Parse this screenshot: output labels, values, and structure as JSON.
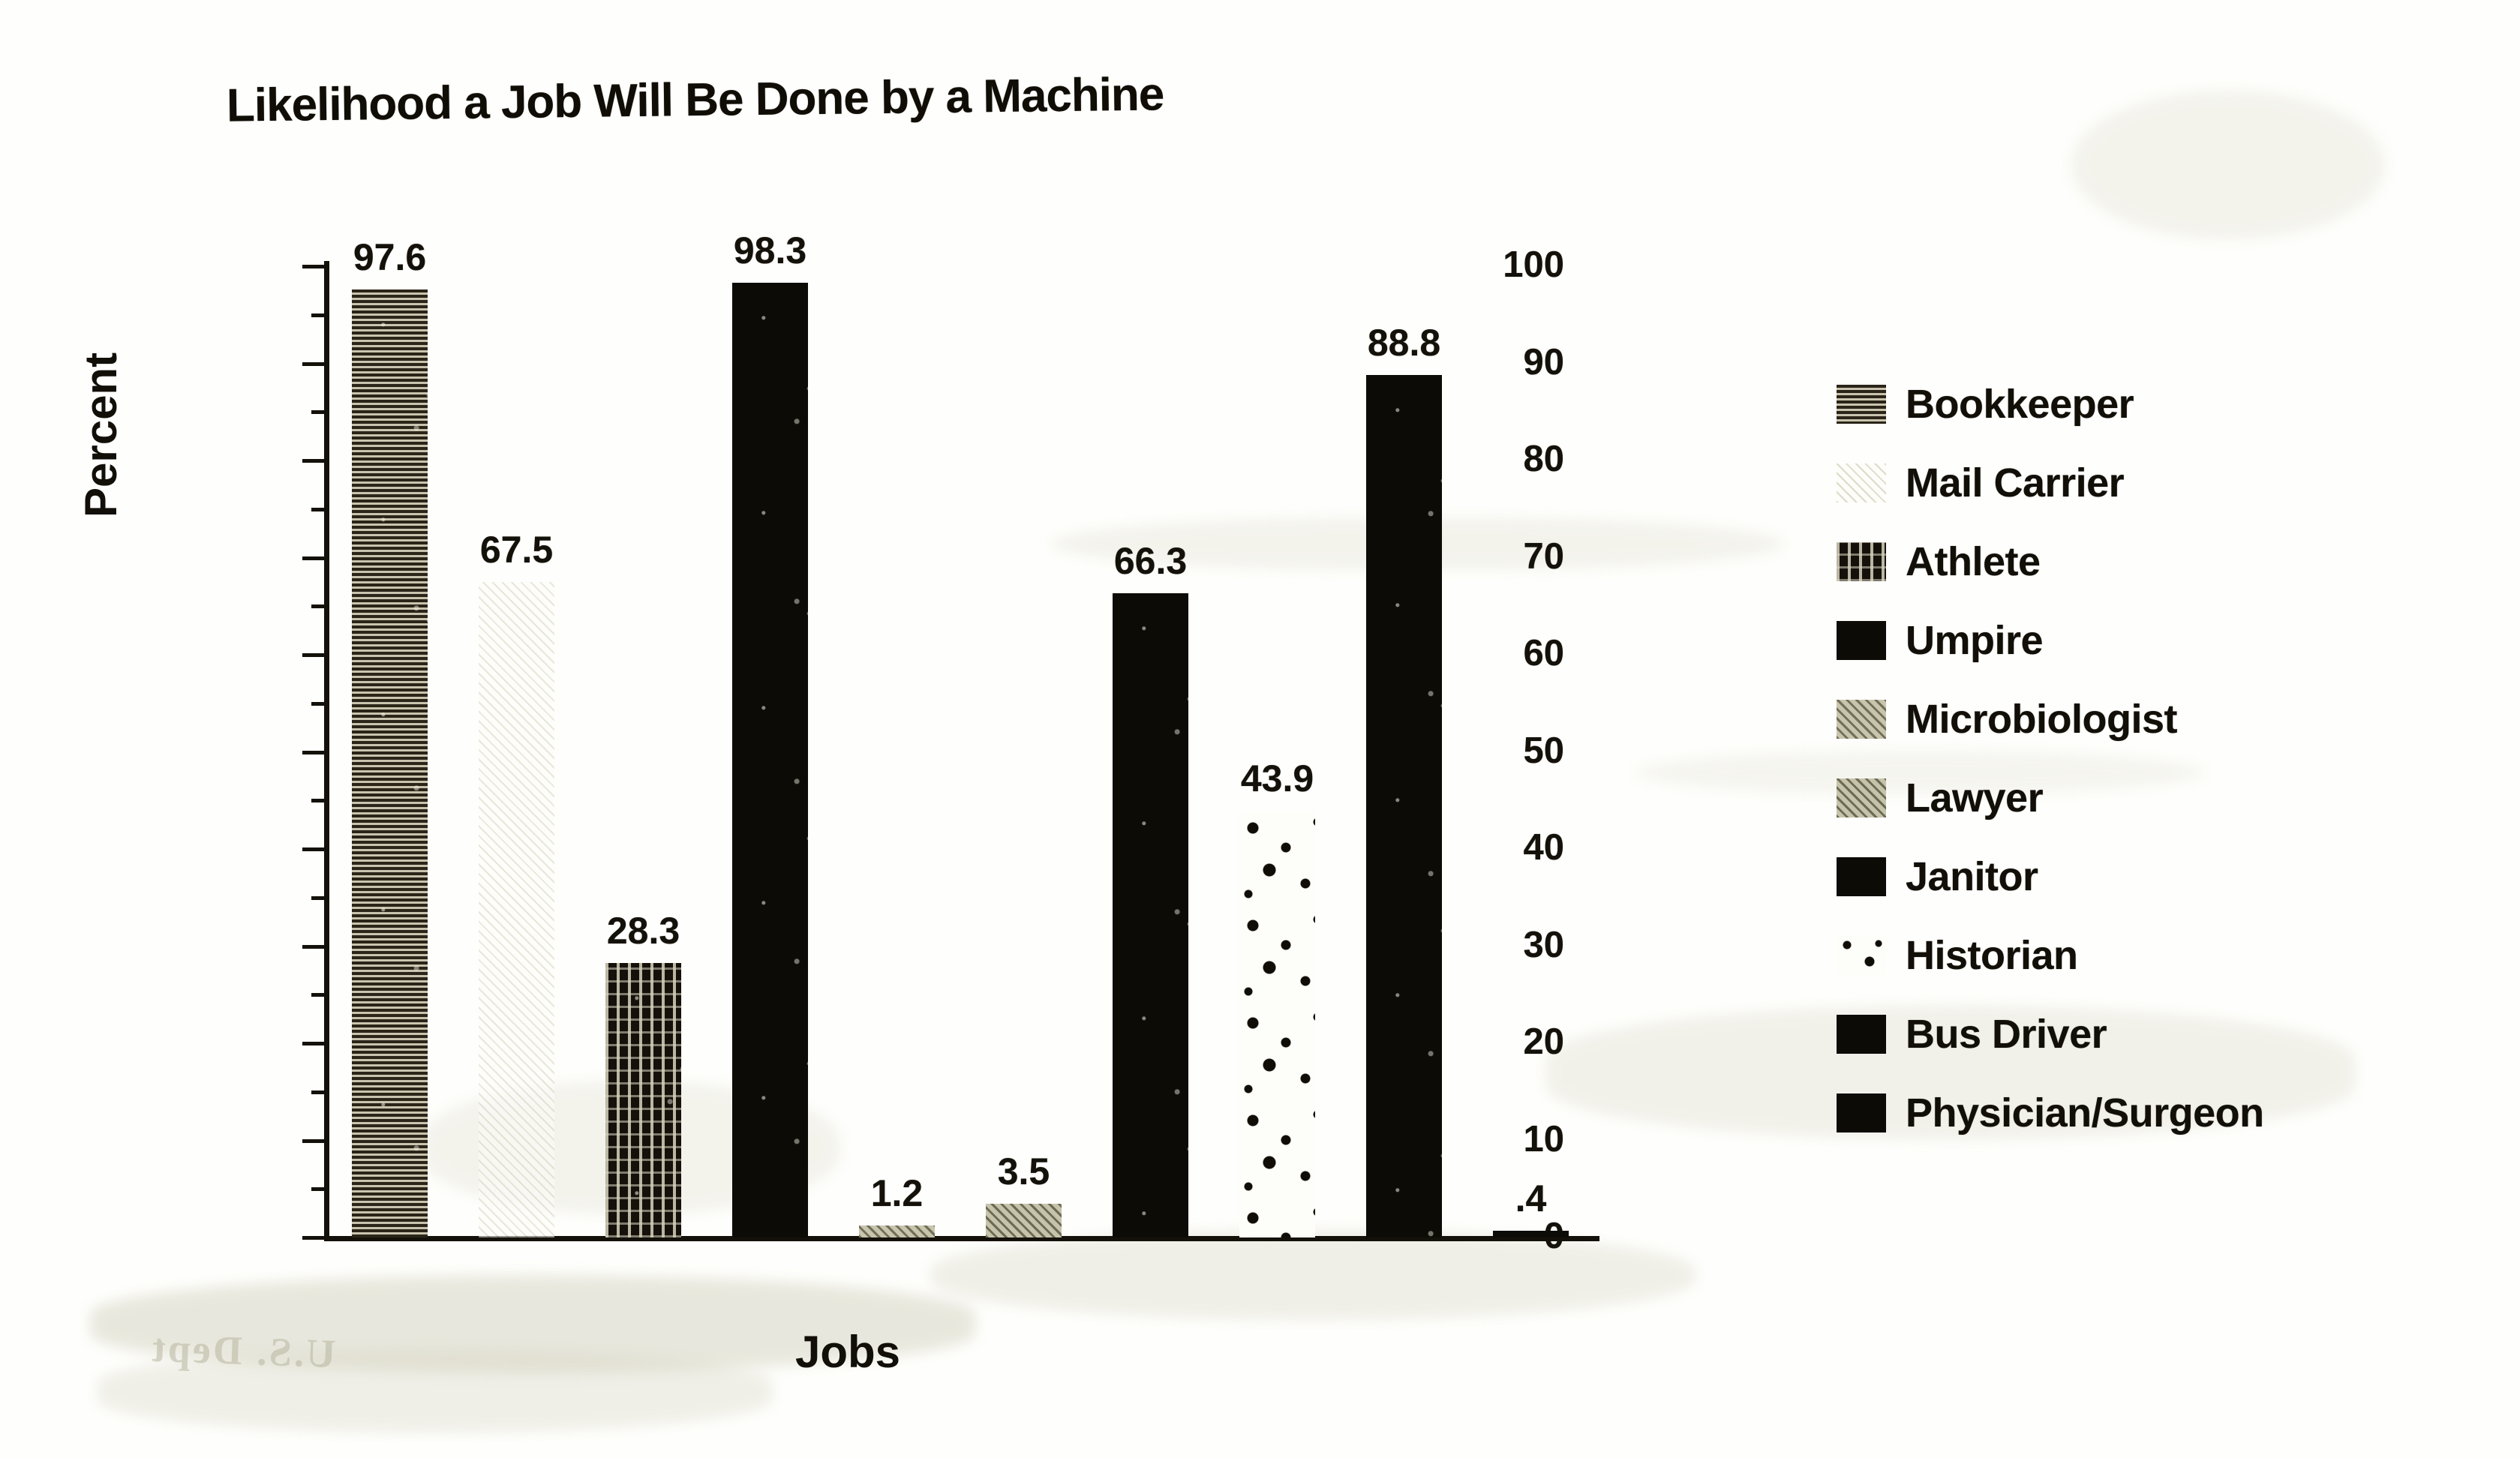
{
  "chart_data": {
    "type": "bar",
    "title": "Likelihood a Job Will Be Done by a Machine",
    "xlabel": "Jobs",
    "ylabel": "Percent",
    "ylim": [
      0,
      100
    ],
    "ytick_step": 10,
    "yminor_step": 5,
    "grid": false,
    "legend_position": "right",
    "categories": [
      "Bookkeeper",
      "Mail Carrier",
      "Athlete",
      "Umpire",
      "Microbiologist",
      "Lawyer",
      "Janitor",
      "Historian",
      "Bus Driver",
      "Physician/Surgeon"
    ],
    "values": [
      97.6,
      67.5,
      28.3,
      98.3,
      1.2,
      3.5,
      66.3,
      43.9,
      88.8,
      0.4
    ],
    "value_labels": [
      "97.6",
      "67.5",
      "28.3",
      "98.3",
      "1.2",
      "3.5",
      "66.3",
      "43.9",
      "88.8",
      ".4"
    ],
    "ytick_labels": [
      "100",
      "90",
      "80",
      "70",
      "60",
      "50",
      "40",
      "30",
      "20",
      "10",
      "0"
    ],
    "patterns": [
      "horizontal-lines",
      "faint-diagonal",
      "dense-crosshatch",
      "solid-black",
      "gray-diagonal",
      "dotted-diagonal",
      "solid-black",
      "sparse-dots",
      "solid-black",
      "solid-black"
    ]
  },
  "legend": {
    "items": [
      {
        "label": "Bookkeeper",
        "pattern": "horizontal-lines"
      },
      {
        "label": "Mail Carrier",
        "pattern": "faint-diagonal"
      },
      {
        "label": "Athlete",
        "pattern": "dense-crosshatch"
      },
      {
        "label": "Umpire",
        "pattern": "solid-black"
      },
      {
        "label": "Microbiologist",
        "pattern": "gray-diagonal"
      },
      {
        "label": "Lawyer",
        "pattern": "dotted-diagonal"
      },
      {
        "label": "Janitor",
        "pattern": "solid-black"
      },
      {
        "label": "Historian",
        "pattern": "sparse-dots"
      },
      {
        "label": "Bus Driver",
        "pattern": "solid-black"
      },
      {
        "label": "Physician/Surgeon",
        "pattern": "solid-black"
      }
    ]
  },
  "artifacts": {
    "ghost_text": "U.S. Dept"
  },
  "colors": {
    "ink": "#14110a",
    "paper": "#fefefc",
    "smudge": "#cfcdb8"
  }
}
